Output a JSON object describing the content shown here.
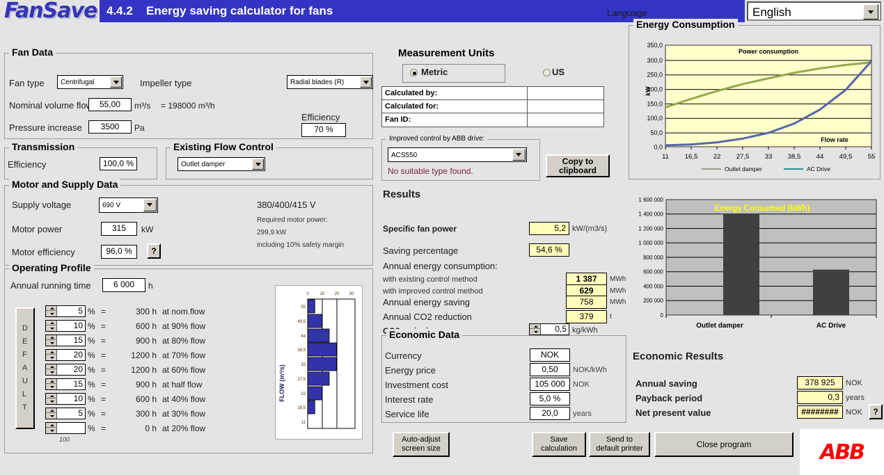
{
  "titlebar": {
    "logo": "FanSave",
    "version": "4.4.2",
    "title": "Energy saving calculator for fans",
    "language_label": "Language",
    "language_value": "English"
  },
  "fan_data": {
    "legend": "Fan Data",
    "fan_type_label": "Fan type",
    "fan_type_value": "Centrifugal",
    "impeller_type_label": "Impeller type",
    "impeller_type_value": "Radial blades     (R)",
    "nominal_flow_label": "Nominal volume flow",
    "nominal_flow_value": "55,00",
    "nominal_flow_unit": "m³/s",
    "nominal_flow_converted": "= 198000 m³/h",
    "pressure_label": "Pressure increase",
    "pressure_value": "3500",
    "pressure_unit": "Pa",
    "efficiency_label": "Efficiency",
    "efficiency_value": "70 %"
  },
  "transmission": {
    "legend": "Transmission",
    "efficiency_label": "Efficiency",
    "efficiency_value": "100,0 %"
  },
  "existing_flow_control": {
    "legend": "Existing Flow Control",
    "value": "Outlet damper"
  },
  "motor": {
    "legend": "Motor and Supply Data",
    "supply_voltage_label": "Supply voltage",
    "supply_voltage_value": "690 V",
    "motor_power_label": "Motor power",
    "motor_power_value": "315",
    "motor_power_unit": "kW",
    "motor_eff_label": "Motor efficiency",
    "motor_eff_value": "96,0 %",
    "help_button": "?",
    "voltage_note": "380/400/415 V",
    "required_power_label": "Required motor power:",
    "required_power_value": "299,9 kW",
    "safety_note": "including 10% safety margin"
  },
  "operating_profile": {
    "legend": "Operating Profile",
    "running_time_label": "Annual running time",
    "running_time_value": "6 000",
    "running_time_unit": "h",
    "default_letters": [
      "D",
      "E",
      "F",
      "A",
      "U",
      "L",
      "T"
    ],
    "footer_note": "100",
    "rows": [
      {
        "pct": "5",
        "hours": "300 h",
        "desc": "at nom.flow"
      },
      {
        "pct": "10",
        "hours": "600 h",
        "desc": "at 90% flow"
      },
      {
        "pct": "15",
        "hours": "900 h",
        "desc": "at 80% flow"
      },
      {
        "pct": "20",
        "hours": "1200 h",
        "desc": "at 70% flow"
      },
      {
        "pct": "20",
        "hours": "1200 h",
        "desc": "at 60% flow"
      },
      {
        "pct": "15",
        "hours": "900 h",
        "desc": "at half  flow"
      },
      {
        "pct": "10",
        "hours": "600 h",
        "desc": "at 40% flow"
      },
      {
        "pct": "5",
        "hours": "300 h",
        "desc": "at 30% flow"
      },
      {
        "pct": "",
        "hours": "0 h",
        "desc": "at 20% flow"
      }
    ]
  },
  "measurement_units": {
    "legend": "Measurement Units",
    "metric_label": "Metric",
    "us_label": "US",
    "selected": "Metric"
  },
  "info_table": {
    "rows": [
      {
        "key": "Calculated by:",
        "value": ""
      },
      {
        "key": "Calculated for:",
        "value": ""
      },
      {
        "key": "Fan ID:",
        "value": ""
      }
    ]
  },
  "abb_drive": {
    "legend": "Improved control by ABB drive:",
    "value": "ACS550",
    "message": "No suitable type found.",
    "copy_button_line1": "Copy to",
    "copy_button_line2": "clipboard"
  },
  "results": {
    "legend": "Results",
    "specific_fan_power_label": "Specific fan power",
    "specific_fan_power_value": "5,2",
    "specific_fan_power_unit": "kW/(m3/s)",
    "saving_pct_label": "Saving percentage",
    "saving_pct_value": "54,6 %",
    "annual_consumption_label": "Annual energy consumption:",
    "existing_label": "with existing control method",
    "existing_value": "1 387",
    "existing_unit": "MWh",
    "improved_label": "with improved control method",
    "improved_value": "629",
    "improved_unit": "MWh",
    "saving_label": "Annual energy saving",
    "saving_value": "758",
    "saving_unit": "MWh",
    "co2_reduction_label": "Annual CO2 reduction",
    "co2_reduction_value": "379",
    "co2_reduction_unit": "t",
    "co2_emission_label": "CO2 emission",
    "co2_emission_value": "0,5",
    "co2_emission_unit": "kg/kWh"
  },
  "economic_data": {
    "legend": "Economic Data",
    "currency_label": "Currency",
    "currency_value": "NOK",
    "energy_price_label": "Energy price",
    "energy_price_value": "0,50",
    "energy_price_unit": "NOK/kWh",
    "investment_label": "Investment cost",
    "investment_value": "105 000",
    "investment_unit": "NOK",
    "interest_label": "Interest rate",
    "interest_value": "5,0 %",
    "service_life_label": "Service life",
    "service_life_value": "20,0",
    "service_life_unit": "years"
  },
  "economic_results": {
    "legend": "Economic Results",
    "annual_saving_label": "Annual  saving",
    "annual_saving_value": "378 925",
    "annual_saving_unit": "NOK",
    "payback_label": "Payback period",
    "payback_value": "0,3",
    "payback_unit": "years",
    "npv_label": "Net present value",
    "npv_value": "########",
    "npv_unit": "NOK",
    "help_button": "?"
  },
  "bottom_buttons": {
    "auto_adjust_l1": "Auto-adjust",
    "auto_adjust_l2": "screen size",
    "save_l1": "Save",
    "save_l2": "calculation",
    "print_l1": "Send to",
    "print_l2": "default printer",
    "close": "Close program",
    "brand": "ABB"
  },
  "colors": {
    "title_blue": "#3434c4",
    "window_bg": "#e4e4e4",
    "field_yellow": "#ffffbb",
    "chart_bg_yellow": "#ffffcc",
    "chart_bg_gray": "#bfbfbf",
    "bar_blue": "#3333aa",
    "line_outlet_damper": "#94a84c",
    "line_ac_drive": "#5566aa",
    "bar_dark": "#404040",
    "abb_red": "#ff0000"
  },
  "chart_data": [
    {
      "id": "energy-consumption-line-chart",
      "type": "line",
      "group_legend": "Energy Consumption",
      "title": "Power consumption",
      "xlabel": "Flow rate",
      "ylabel": "kW",
      "x": [
        11,
        16.5,
        22,
        27.5,
        33,
        38.5,
        44,
        49.5,
        55
      ],
      "xticks": [
        "11",
        "16,5",
        "22",
        "27,5",
        "33",
        "38,5",
        "44",
        "49,5",
        "55"
      ],
      "yticks": [
        "0,0",
        "50,0",
        "100,0",
        "150,0",
        "200,0",
        "250,0",
        "300,0",
        "350,0"
      ],
      "ylim": [
        0,
        350
      ],
      "xlim": [
        11,
        55
      ],
      "grid": true,
      "legend_position": "bottom",
      "series": [
        {
          "name": "Outlet damper",
          "color": "#94a84c",
          "values": [
            136,
            165,
            192,
            216,
            236,
            255,
            270,
            282,
            291
          ]
        },
        {
          "name": "AC Drive",
          "color": "#5566aa",
          "values": [
            5,
            8,
            15,
            28,
            48,
            80,
            128,
            196,
            295
          ]
        }
      ]
    },
    {
      "id": "energy-consumed-bar-chart",
      "type": "bar",
      "title": "Energy Consumed (kWh)",
      "categories": [
        "Outlet damper",
        "AC Drive"
      ],
      "values": [
        1387000,
        629000
      ],
      "yticks": [
        "0",
        "200 000",
        "400 000",
        "600 000",
        "800 000",
        "1 000 000",
        "1 200 000",
        "1 400 000",
        "1 600 000"
      ],
      "ylim": [
        0,
        1600000
      ],
      "grid": true,
      "bar_color": "#404040",
      "plot_bg": "#bfbfbf"
    },
    {
      "id": "operating-profile-bar-chart",
      "type": "bar",
      "orientation": "horizontal",
      "ylabel": "FLOW (m³/s)",
      "categories": [
        "55",
        "49,5",
        "44",
        "38,5",
        "33",
        "27,5",
        "22",
        "16,5",
        "11"
      ],
      "values": [
        5,
        10,
        15,
        20,
        20,
        15,
        10,
        5,
        0
      ],
      "xticks": [
        "0",
        "10",
        "20",
        "30"
      ],
      "xlim": [
        0,
        30
      ],
      "bar_color": "#3333aa"
    }
  ]
}
